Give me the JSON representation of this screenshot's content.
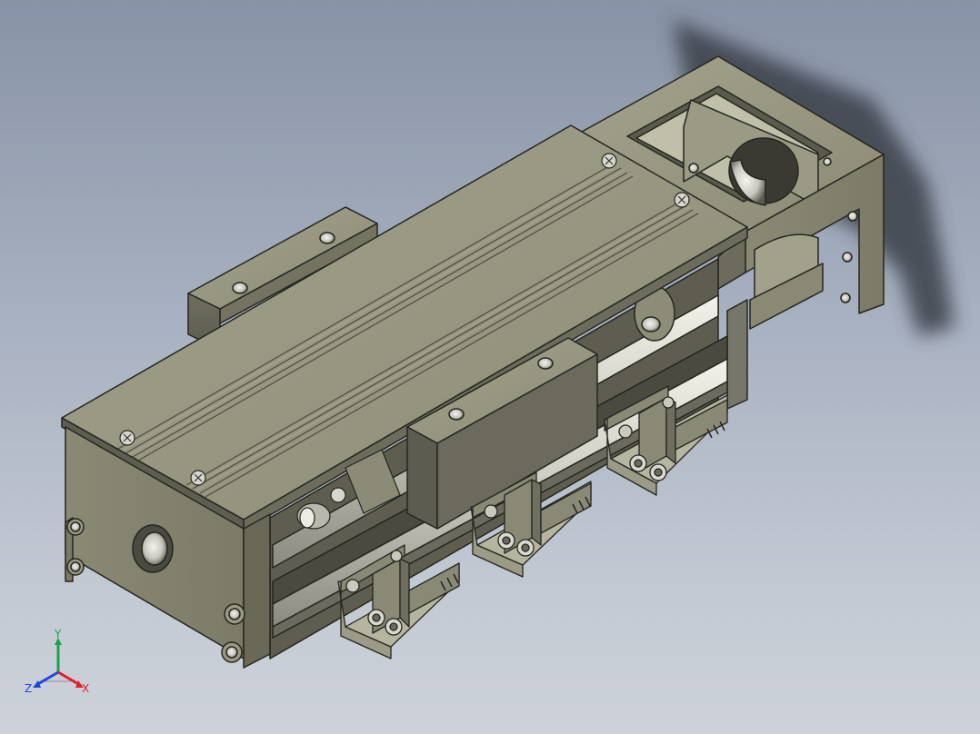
{
  "viewport": {
    "background_top": "#8793a6",
    "background_bottom": "#cdd2da"
  },
  "part_colors": {
    "body": "#8f8e78",
    "body_dark": "#6b6a5a",
    "body_light": "#b9b8a0",
    "edge": "#2a2a24",
    "rail": "#d6d6cc",
    "carriage": "#7a7a70"
  },
  "triad": {
    "x_label": "X",
    "y_label": "Y",
    "z_label": "Z",
    "x_color": "#e0202a",
    "y_color": "#18a34a",
    "z_color": "#2046e0"
  }
}
